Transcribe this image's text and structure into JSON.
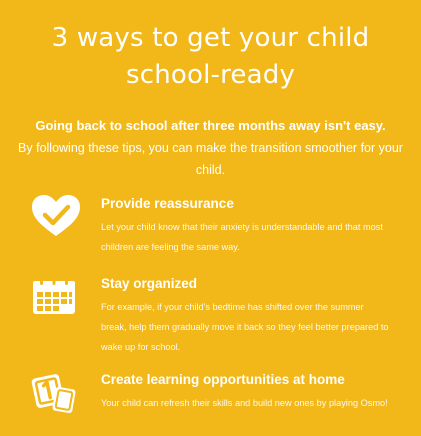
{
  "title": {
    "line1": "3 ways to get your child",
    "line2": "school-ready"
  },
  "intro": {
    "bold": "Going back to school after three months away isn't easy.",
    "text": "By following these tips, you can make the transition smoother for your child."
  },
  "items": [
    {
      "icon": "heart-check-icon",
      "heading": "Provide reassurance",
      "body": "Let your child know that their anxiety is understandable and that most children are feeling the same way."
    },
    {
      "icon": "calendar-icon",
      "heading": "Stay organized",
      "body": "For example, if your child's bedtime has shifted over the summer break, help them gradually move it back so they feel better prepared to wake up for school."
    },
    {
      "icon": "number-tiles-icon",
      "heading": "Create learning opportunities at home",
      "body": "Your child can refresh their skills and build new ones by playing Osmo!"
    }
  ],
  "colors": {
    "background": "#f2b819",
    "text": "#ffffff"
  }
}
